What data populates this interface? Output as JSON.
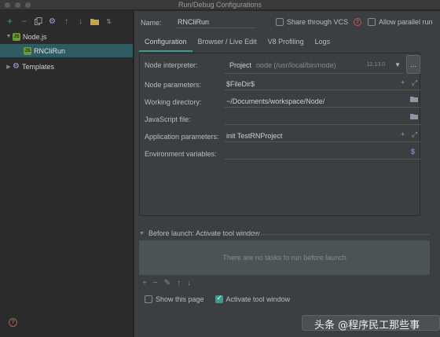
{
  "window": {
    "title": "Run/Debug Configurations"
  },
  "sidebar": {
    "toolbar_icons": [
      "add-icon",
      "remove-icon",
      "copy-icon",
      "gear-icon",
      "move-up-icon",
      "move-down-icon",
      "folder-icon",
      "sort-icon"
    ],
    "tree": [
      {
        "label": "Node.js",
        "expanded": true,
        "icon": "nodejs-icon"
      },
      {
        "label": "RNCliRun",
        "selected": true,
        "icon": "nodejs-icon"
      },
      {
        "label": "Templates",
        "expanded": false,
        "icon": "gear-icon"
      }
    ]
  },
  "header": {
    "name_label": "Name:",
    "name_value": "RNCliRun",
    "share_label": "Share through VCS",
    "share_checked": false,
    "parallel_label": "Allow parallel run",
    "parallel_checked": false
  },
  "tabs": [
    {
      "label": "Configuration",
      "active": true
    },
    {
      "label": "Browser / Live Edit",
      "active": false
    },
    {
      "label": "V8 Profiling",
      "active": false
    },
    {
      "label": "Logs",
      "active": false
    }
  ],
  "config": {
    "interpreter": {
      "label": "Node interpreter:",
      "project": "Project",
      "path": "node (/usr/local/bin/node)",
      "version": "12.13.0",
      "more_label": "..."
    },
    "node_params": {
      "label": "Node parameters:",
      "value": "$FileDir$"
    },
    "working_dir": {
      "label": "Working directory:",
      "value": "~/Documents/workspace/Node/"
    },
    "js_file": {
      "label": "JavaScript file:",
      "value": ""
    },
    "app_params": {
      "label": "Application parameters:",
      "value": "init TestRNProject"
    },
    "env_vars": {
      "label": "Environment variables:",
      "value": ""
    }
  },
  "before_launch": {
    "title": "Before launch: Activate tool window",
    "empty_text": "There are no tasks to run before launch",
    "show_page_label": "Show this page",
    "show_page_checked": false,
    "activate_label": "Activate tool window",
    "activate_checked": true
  },
  "watermark": {
    "text": "头条 @程序民工那些事"
  },
  "colors": {
    "accent": "#3d9b8e",
    "selection": "#2f5b63",
    "error": "#c75450"
  }
}
